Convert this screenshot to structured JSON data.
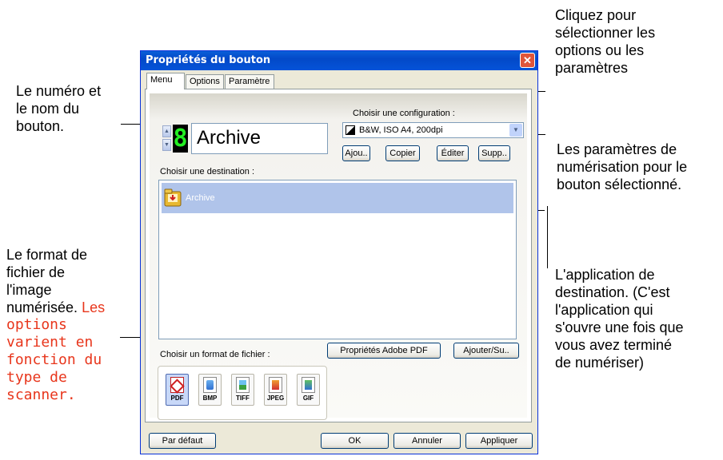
{
  "annotations": {
    "select_options_lines": [
      "Cliquez pour",
      "sélectionner les",
      "options ou les",
      "paramètres"
    ],
    "button_number_lines": [
      "Le numéro et",
      "le nom du",
      "bouton."
    ],
    "scan_settings_lines": [
      "Les paramètres de",
      "numérisation pour le",
      "bouton sélectionné."
    ],
    "file_format_lines": [
      "Le format de",
      "fichier de",
      "l'image",
      "numérisée."
    ],
    "file_format_red_lines": [
      "Les",
      "options",
      "varient en",
      "fonction du",
      "type de",
      "scanner."
    ],
    "destination_app_lines": [
      "L'application de",
      "destination. (C'est",
      "l'application qui",
      "s'ouvre une fois que",
      "vous avez terminé",
      "de numériser)"
    ]
  },
  "dialog": {
    "title": "Propriétés du bouton",
    "close_symbol": "✕",
    "tabs": [
      "Menu",
      "Options",
      "Paramètre"
    ],
    "button_number": "8",
    "button_name": "Archive",
    "config_label": "Choisir une configuration :",
    "config_value": "B&W, ISO A4, 200dpi",
    "config_buttons": [
      "Ajou..",
      "Copier",
      "Éditer",
      "Supp.."
    ],
    "destination_label": "Choisir une destination :",
    "destinations": [
      {
        "name": "Archive"
      }
    ],
    "file_format_label": "Choisir un format de fichier :",
    "pdf_props_button": "Propriétés Adobe PDF",
    "add_remove_button": "Ajouter/Su..",
    "formats": [
      "PDF",
      "BMP",
      "TIFF",
      "JPEG",
      "GIF"
    ],
    "selected_format": "PDF",
    "footer": {
      "default_button": "Par défaut",
      "ok_button": "OK",
      "cancel_button": "Annuler",
      "apply_button": "Appliquer"
    }
  },
  "colors": {
    "titlebar": "#0453d8",
    "highlight_row": "#b0c4ea",
    "annotation_red": "#e8361c",
    "digit_green": "#22ee22"
  }
}
